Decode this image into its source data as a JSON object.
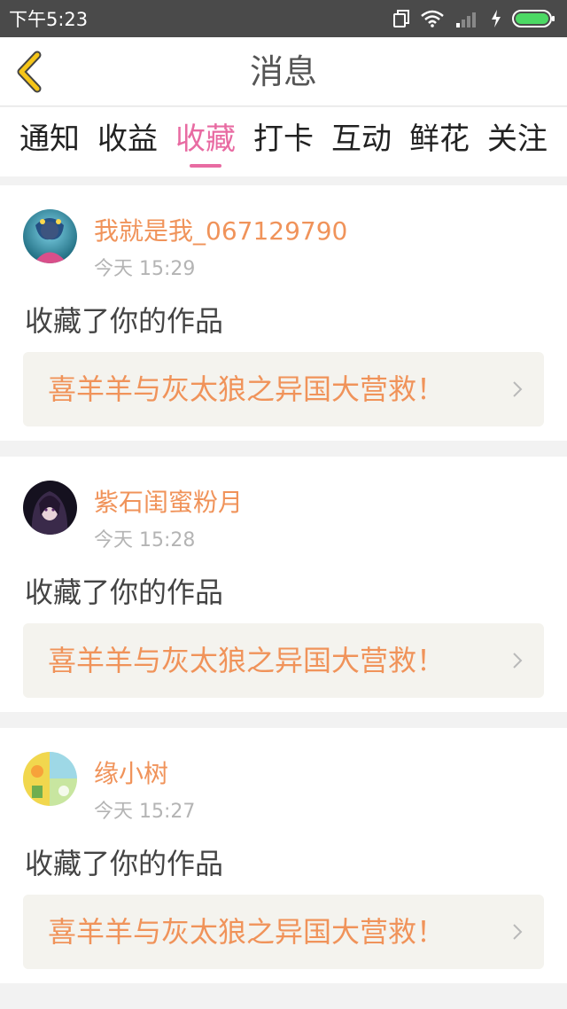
{
  "status_bar": {
    "time": "下午5:23"
  },
  "header": {
    "title": "消息"
  },
  "tabs": [
    {
      "label": "通知",
      "active": false
    },
    {
      "label": "收益",
      "active": false
    },
    {
      "label": "收藏",
      "active": true
    },
    {
      "label": "打卡",
      "active": false
    },
    {
      "label": "互动",
      "active": false
    },
    {
      "label": "鲜花",
      "active": false
    },
    {
      "label": "关注",
      "active": false
    }
  ],
  "messages": [
    {
      "user": "我就是我_067129790",
      "time": "今天 15:29",
      "action": "收藏了你的作品",
      "work_title": "喜羊羊与灰太狼之异国大营救！"
    },
    {
      "user": "紫石闺蜜粉月",
      "time": "今天 15:28",
      "action": "收藏了你的作品",
      "work_title": "喜羊羊与灰太狼之异国大营救！"
    },
    {
      "user": "缘小树",
      "time": "今天 15:27",
      "action": "收藏了你的作品",
      "work_title": "喜羊羊与灰太狼之异国大营救！"
    }
  ],
  "colors": {
    "accent_pink": "#e86ba2",
    "username_orange": "#f0935a",
    "back_arrow_yellow": "#f5c518",
    "battery_green": "#4cd964"
  }
}
